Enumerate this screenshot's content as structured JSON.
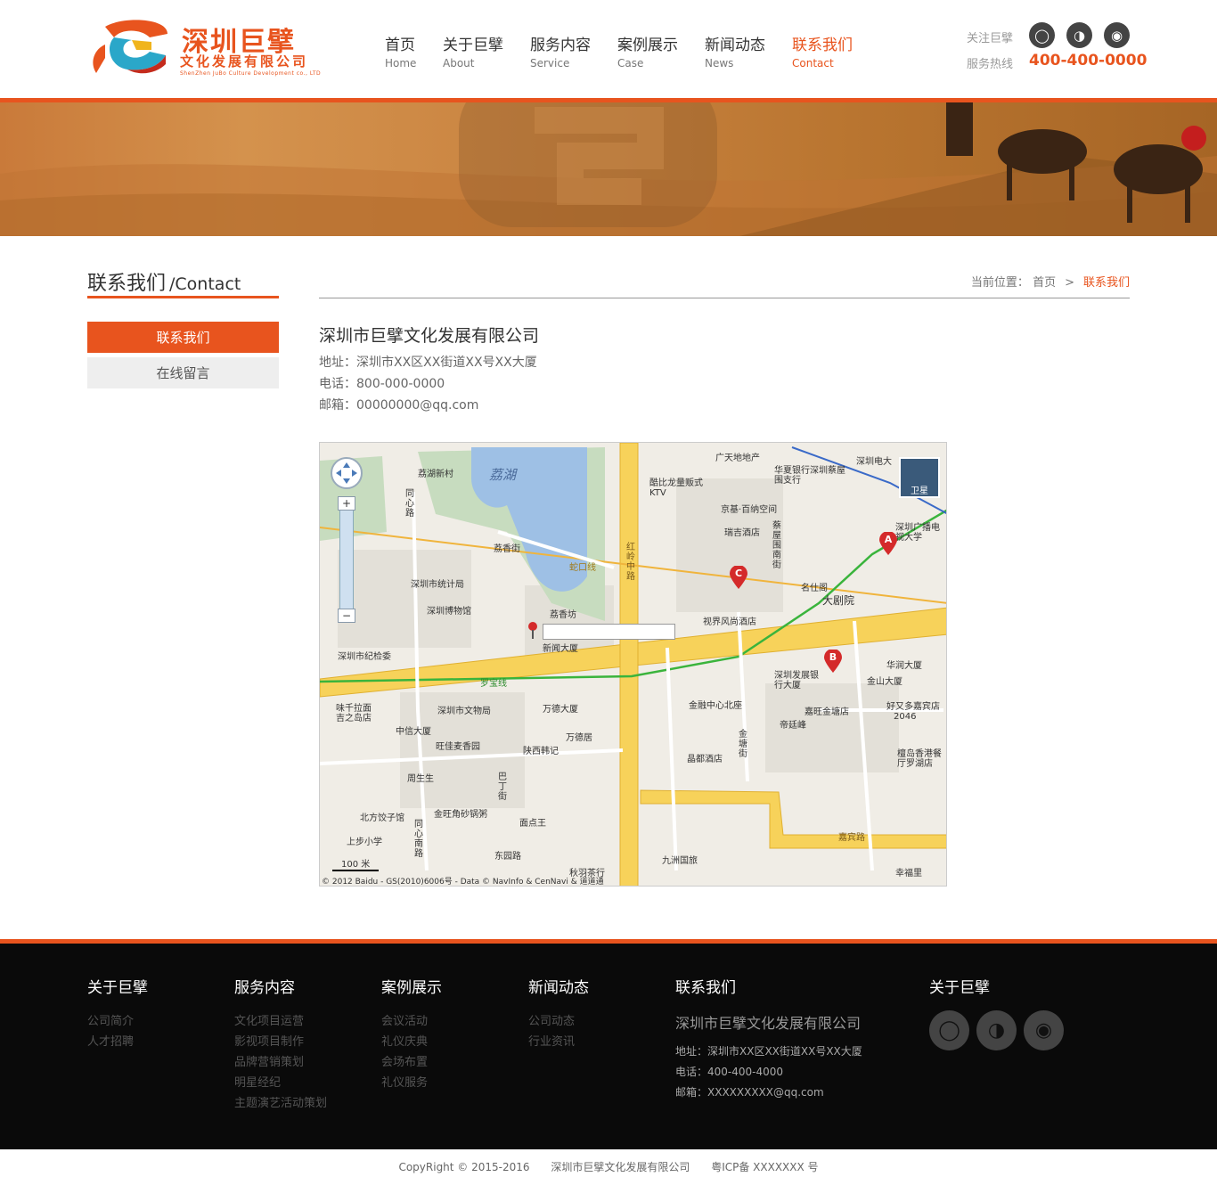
{
  "header": {
    "logo_cn": "深圳巨擘",
    "logo_sub": "文化发展有限公司",
    "logo_en": "ShenZhen JuBo Culture Development co., LTD",
    "nav": [
      {
        "cn": "首页",
        "en": "Home"
      },
      {
        "cn": "关于巨擘",
        "en": "About"
      },
      {
        "cn": "服务内容",
        "en": "Service"
      },
      {
        "cn": "案例展示",
        "en": "Case"
      },
      {
        "cn": "新闻动态",
        "en": "News"
      },
      {
        "cn": "联系我们",
        "en": "Contact"
      }
    ],
    "follow_label": "关注巨擘",
    "hotline_label": "服务热线",
    "hotline": "400-400-0000",
    "icons": [
      "qq-icon",
      "wechat-icon",
      "weibo-icon"
    ]
  },
  "sidebar": {
    "title_cn": "联系我们",
    "title_en": "/Contact",
    "items": [
      "联系我们",
      "在线留言"
    ]
  },
  "breadcrumb": {
    "label": "当前位置：",
    "home": "首页",
    "sep": ">",
    "current": "联系我们"
  },
  "contact": {
    "company": "深圳市巨擘文化发展有限公司",
    "address": "地址：深圳市XX区XX街道XX号XX大厦",
    "phone": "电话：800-000-0000",
    "email": "邮箱：00000000@qq.com"
  },
  "map": {
    "labels": {
      "lake": "荔湖",
      "l1": "荔湖新村",
      "l2": "同心路",
      "l3": "荔香街",
      "l4": "深圳市统计局",
      "l5": "深圳博物馆",
      "l6": "荔香坊",
      "l7": "新闻大厦",
      "l8": "深圳市纪检委",
      "l9": "罗宝线",
      "l10": "深圳市文物局",
      "l11": "万德大厦",
      "l12": "中信大厦",
      "l13": "旺佳麦香园",
      "l14": "陕西韩记",
      "l15": "周生生",
      "l16": "北方饺子馆",
      "l17": "金旺角砂锅粥",
      "l18": "面点王",
      "l19": "上步小学",
      "l20": "东园路",
      "l21": "秋羽茶行",
      "l22": "广天地地产",
      "l23": "华夏银行深圳蔡屋围支行",
      "l24": "深圳电大",
      "l25": "酷比龙量贩式KTV",
      "l26": "京基·百纳空间",
      "l27": "瑞吉酒店",
      "l28": "名仕阁",
      "l29": "大剧院",
      "l30": "视界风尚酒店",
      "l31": "深圳广播电视大学",
      "l32": "深圳发展银行大厦",
      "l33": "华润大厦",
      "l34": "金山大厦",
      "l35": "金融中心北座",
      "l36": "嘉旺金塘店",
      "l37": "帝廷峰",
      "l38": "好又多嘉宾店",
      "l39": "晶都酒店",
      "l40": "檀岛香港餐厅罗湖店",
      "l41": "嘉宾路",
      "l42": "九洲国旅",
      "l43": "幸福里",
      "l44": "红岭中路",
      "l45": "万德居",
      "l46": "蔡屋围南街",
      "l47": "金塘街",
      "l48": "巴丁街",
      "l49": "味千拉面吉之岛店",
      "l50": "同心南路",
      "l51": "2046",
      "l52": "蛇口线"
    },
    "satellite": "卫星",
    "scale": "100 米",
    "copyright": "© 2012 Baidu - GS(2010)6006号 - Data © NavInfo & CenNavi & 道道通",
    "markers": [
      "A",
      "B",
      "C"
    ]
  },
  "footer": {
    "cols": [
      {
        "title": "关于巨擘",
        "links": [
          "公司简介",
          "人才招聘"
        ]
      },
      {
        "title": "服务内容",
        "links": [
          "文化项目运营",
          "影视项目制作",
          "品牌营销策划",
          "明星经纪",
          "主题演艺活动策划"
        ]
      },
      {
        "title": "案例展示",
        "links": [
          "会议活动",
          "礼仪庆典",
          "会场布置",
          "礼仪服务"
        ]
      },
      {
        "title": "新闻动态",
        "links": [
          "公司动态",
          "行业资讯"
        ]
      }
    ],
    "contact_title": "联系我们",
    "contact_company": "深圳市巨擘文化发展有限公司",
    "contact_address": "地址：深圳市XX区XX街道XX号XX大厦",
    "contact_phone": "电话：400-400-4000",
    "contact_email": "邮箱：XXXXXXXXX@qq.com",
    "follow_title": "关于巨擘"
  },
  "copyright": {
    "text": "CopyRight © 2015-2016",
    "company": "深圳市巨擘文化发展有限公司",
    "icp": "粤ICP备 XXXXXXX 号"
  },
  "colors": {
    "accent": "#e8541e",
    "footer_bg": "#0a0a0a"
  }
}
